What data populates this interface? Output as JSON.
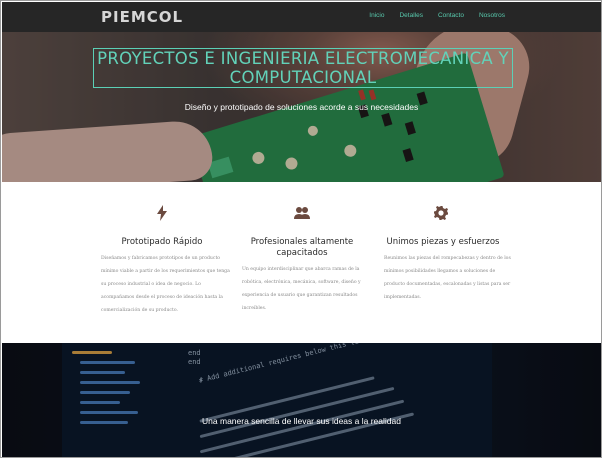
{
  "nav": {
    "logo": "PIEMCOL",
    "links": [
      "Inicio",
      "Detalles",
      "Contacto",
      "Nosotros"
    ]
  },
  "hero": {
    "title": "PROYECTOS E INGENIERIA ELECTROMECANICA Y COMPUTACIONAL",
    "subtitle": "Diseño y prototipado de soluciones acorde a sus necesidades"
  },
  "features": [
    {
      "icon": "lightning-bolt-icon",
      "title": "Prototipado Rápido",
      "description": "Diseñamos y fabricamos prototipos de un producto mínimo viable a partir de los requerimientos que tenga su proceso industrial o idea de negocio. Lo acompañamos desde el proceso de ideación hasta la comercialización de su producto."
    },
    {
      "icon": "people-icon",
      "title": "Profesionales altamente capacitados",
      "description": "Un equipo interdisciplinar que abarca ramas de la robótica, electrónica, mecánica, software, diseño y experiencia de usuario que garantizan resultados increíbles."
    },
    {
      "icon": "gear-icon",
      "title": "Unimos piezas y esfuerzos",
      "description": "Reunimos las piezas del rompecabezas y dentro de los mínimos posibilidades llegamos a soluciones de producto documentadas, escalonadas y listas para ser implementadas."
    }
  ],
  "banner": {
    "text": "Una manera sencilla de llevar sus ideas a la realidad",
    "code_snippets": [
      "end",
      "end",
      "# Add additional requires below this line."
    ]
  },
  "colors": {
    "nav_bg": "#262626",
    "accent": "#58c9ad",
    "icon_brown": "#6b4a3f"
  }
}
